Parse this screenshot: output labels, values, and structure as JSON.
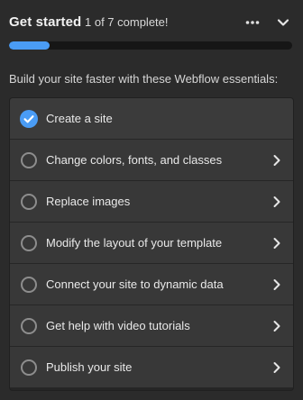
{
  "header": {
    "title": "Get started",
    "progress_text": "1 of 7 complete!",
    "progress_fraction": 0.143,
    "icons": {
      "more": "more-horizontal-icon",
      "collapse": "chevron-down-icon"
    }
  },
  "intro": "Build your site faster with these Webflow essentials:",
  "colors": {
    "accent": "#4a9cf5",
    "background": "#2b2b2b",
    "item": "#383838"
  },
  "tasks": [
    {
      "label": "Create a site",
      "completed": true
    },
    {
      "label": "Change colors, fonts, and classes",
      "completed": false
    },
    {
      "label": "Replace images",
      "completed": false
    },
    {
      "label": "Modify the layout of your template",
      "completed": false
    },
    {
      "label": "Connect your site to dynamic data",
      "completed": false
    },
    {
      "label": "Get help with video tutorials",
      "completed": false
    },
    {
      "label": "Publish your site",
      "completed": false
    }
  ]
}
